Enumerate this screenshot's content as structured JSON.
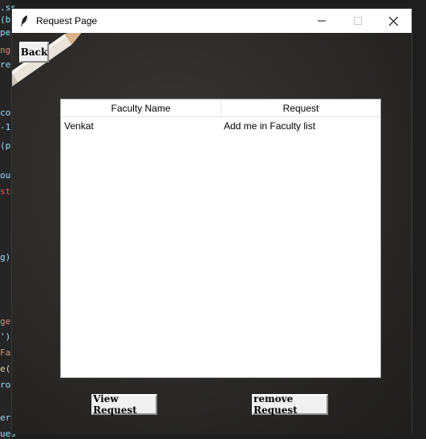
{
  "window": {
    "title": "Request Page"
  },
  "back_button": {
    "label": "Back"
  },
  "table": {
    "columns": [
      "Faculty Name",
      "Request"
    ],
    "rows": [
      [
        "Venkat",
        "Add me in Faculty list"
      ]
    ]
  },
  "actions": {
    "view_label": "View Request",
    "remove_label": "remove Request"
  }
}
